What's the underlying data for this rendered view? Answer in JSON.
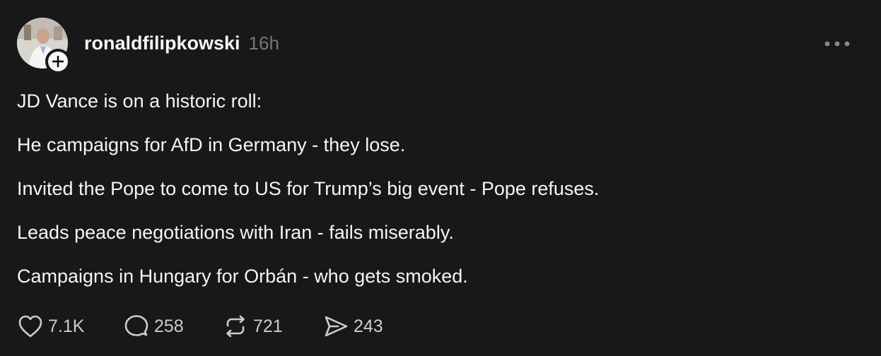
{
  "post": {
    "author": {
      "username": "ronaldfilipkowski",
      "timestamp": "16h"
    },
    "lines": [
      "JD Vance is on a historic roll:",
      "He campaigns for AfD in Germany - they lose.",
      "Invited the Pope to come to US for Trump’s big event - Pope refuses.",
      "Leads peace negotiations with Iran - fails miserably.",
      "Campaigns in Hungary for Orbán - who gets smoked."
    ],
    "actions": {
      "likes": "7.1K",
      "replies": "258",
      "reposts": "721",
      "shares": "243"
    }
  },
  "icons": {
    "avatar": "avatar",
    "follow": "plus-icon",
    "more": "more-horizontal-icon",
    "like": "heart-icon",
    "reply": "comment-icon",
    "repost": "repost-icon",
    "share": "send-icon"
  },
  "colors": {
    "background": "#181818",
    "text": "#f3f5f7",
    "secondary": "#777777"
  }
}
